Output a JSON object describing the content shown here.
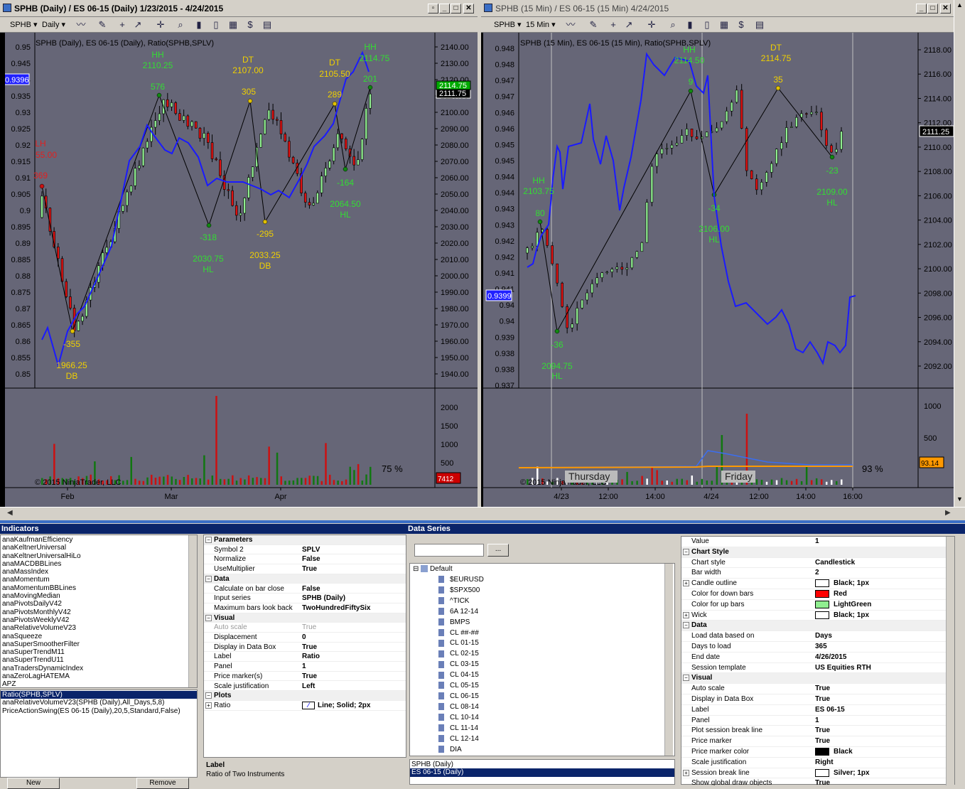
{
  "left_window": {
    "title": "SPHB (Daily) / ES 06-15 (Daily)  1/23/2015 - 4/24/2015",
    "instrument": "SPHB",
    "period": "Daily",
    "plot_label": "SPHB (Daily), ES 06-15 (Daily), Ratio(SPHB,SPLV)",
    "copyright": "© 2015 NinjaTrader, LLC",
    "pct": "75 %",
    "ratio_marker": "0.9396",
    "price_marker": "2111.75",
    "price_marker2": "2114.75",
    "vol_marker": "7412",
    "left_axis": [
      "0.95",
      "0.945",
      "0.94",
      "0.935",
      "0.93",
      "0.925",
      "0.92",
      "0.915",
      "0.91",
      "0.905",
      "0.9",
      "0.895",
      "0.89",
      "0.885",
      "0.88",
      "0.875",
      "0.87",
      "0.865",
      "0.86",
      "0.855",
      "0.85"
    ],
    "right_axis": [
      "2140.00",
      "2130.00",
      "2120.00",
      "2110.00",
      "2100.00",
      "2090.00",
      "2080.00",
      "2070.00",
      "2060.00",
      "2050.00",
      "2040.00",
      "2030.00",
      "2020.00",
      "2010.00",
      "2000.00",
      "1990.00",
      "1980.00",
      "1970.00",
      "1960.00",
      "1950.00",
      "1940.00"
    ],
    "vol_axis": [
      "2000",
      "1500",
      "1000",
      "500"
    ],
    "x_axis": [
      "Feb",
      "Mar",
      "Apr"
    ],
    "annotations": [
      {
        "t": "LH",
        "c": "#e02020"
      },
      {
        "t": "55.00",
        "c": "#e02020"
      },
      {
        "t": "369",
        "c": "#e02020"
      },
      {
        "t": "HH",
        "c": "#33dd33"
      },
      {
        "t": "2110.25",
        "c": "#33dd33"
      },
      {
        "t": "576",
        "c": "#33dd33"
      },
      {
        "t": "DT",
        "c": "#f0d000"
      },
      {
        "t": "2107.00",
        "c": "#f0d000"
      },
      {
        "t": "305",
        "c": "#f0d000"
      },
      {
        "t": "DT",
        "c": "#f0d000"
      },
      {
        "t": "2105.50",
        "c": "#f0d000"
      },
      {
        "t": "289",
        "c": "#f0d000"
      },
      {
        "t": "HH",
        "c": "#33dd33"
      },
      {
        "t": "2114.75",
        "c": "#33dd33"
      },
      {
        "t": "201",
        "c": "#33dd33"
      },
      {
        "t": "-318",
        "c": "#33dd33"
      },
      {
        "t": "2030.75",
        "c": "#33dd33"
      },
      {
        "t": "HL",
        "c": "#33dd33"
      },
      {
        "t": "-295",
        "c": "#f0d000"
      },
      {
        "t": "2033.25",
        "c": "#f0d000"
      },
      {
        "t": "DB",
        "c": "#f0d000"
      },
      {
        "t": "-164",
        "c": "#33dd33"
      },
      {
        "t": "2064.50",
        "c": "#33dd33"
      },
      {
        "t": "HL",
        "c": "#33dd33"
      },
      {
        "t": "-355",
        "c": "#f0d000"
      },
      {
        "t": "1966.25",
        "c": "#f0d000"
      },
      {
        "t": "DB",
        "c": "#f0d000"
      }
    ]
  },
  "right_window": {
    "title": "SPHB (15 Min) / ES 06-15 (15 Min)  4/24/2015",
    "instrument": "SPHB",
    "period": "15 Min",
    "plot_label": "SPHB (15 Min), ES 06-15 (15 Min), Ratio(SPHB,SPLV)",
    "copyright": "© 2015 NinjaTrader, LLC",
    "pct": "93 %",
    "ratio_marker": "0.9399",
    "price_marker": "2111.25",
    "vol_marker": "93.14",
    "session_labels": [
      "Thursday",
      "Friday"
    ],
    "left_axis": [
      "0.948",
      "0.948",
      "0.947",
      "0.947",
      "0.946",
      "0.946",
      "0.945",
      "0.945",
      "0.944",
      "0.944",
      "0.943",
      "0.943",
      "0.942",
      "0.942",
      "0.941",
      "0.941",
      "0.94",
      "0.94",
      "0.939",
      "0.938",
      "0.938",
      "0.937"
    ],
    "right_axis": [
      "2118.00",
      "2116.00",
      "2114.00",
      "2112.00",
      "2110.00",
      "2108.00",
      "2106.00",
      "2104.00",
      "2102.00",
      "2100.00",
      "2098.00",
      "2096.00",
      "2094.00",
      "2092.00"
    ],
    "vol_axis": [
      "1000",
      "500"
    ],
    "x_axis": [
      "4/23",
      "12:00",
      "14:00",
      "4/24",
      "12:00",
      "14:00",
      "16:00"
    ],
    "annotations": [
      {
        "t": "HH",
        "c": "#33dd33"
      },
      {
        "t": "2103.75",
        "c": "#33dd33"
      },
      {
        "t": "80",
        "c": "#33dd33"
      },
      {
        "t": "HH",
        "c": "#33dd33"
      },
      {
        "t": "2114.50",
        "c": "#33dd33"
      },
      {
        "t": "9",
        "c": "#33dd33"
      },
      {
        "t": "DT",
        "c": "#f0d000"
      },
      {
        "t": "2114.75",
        "c": "#f0d000"
      },
      {
        "t": "35",
        "c": "#f0d000"
      },
      {
        "t": "-36",
        "c": "#33dd33"
      },
      {
        "t": "2094.75",
        "c": "#33dd33"
      },
      {
        "t": "HL",
        "c": "#33dd33"
      },
      {
        "t": "-34",
        "c": "#33dd33"
      },
      {
        "t": "2106.00",
        "c": "#33dd33"
      },
      {
        "t": "HL",
        "c": "#33dd33"
      },
      {
        "t": "-23",
        "c": "#33dd33"
      },
      {
        "t": "2109.00",
        "c": "#33dd33"
      },
      {
        "t": "HL",
        "c": "#33dd33"
      }
    ]
  },
  "indicators": {
    "header": "Indicators",
    "available": [
      "anaKaufmanEfficiency",
      "anaKeltnerUniversal",
      "anaKeltnerUniversalHiLo",
      "anaMACDBBLines",
      "anaMassIndex",
      "anaMomentum",
      "anaMomentumBBLines",
      "anaMovingMedian",
      "anaPivotsDailyV42",
      "anaPivotsMonthlyV42",
      "anaPivotsWeeklyV42",
      "anaRelativeVolumeV23",
      "anaSqueeze",
      "anaSuperSmootherFilter",
      "anaSuperTrendM11",
      "anaSuperTrendU11",
      "anaTradersDynamicIndex",
      "anaZeroLagHATEMA",
      "APZ"
    ],
    "applied": [
      "Ratio(SPHB,SPLV)",
      "anaRelativeVolumeV23(SPHB (Daily),All_Days,5,8)",
      "PriceActionSwing(ES 06-15 (Daily),20,5,Standard,False)"
    ],
    "new_btn": "New",
    "remove_btn": "Remove",
    "properties": [
      {
        "cat": "Parameters"
      },
      {
        "k": "Symbol 2",
        "v": "SPLV"
      },
      {
        "k": "Normalize",
        "v": "False"
      },
      {
        "k": "UseMultiplier",
        "v": "True"
      },
      {
        "cat": "Data"
      },
      {
        "k": "Calculate on bar close",
        "v": "False"
      },
      {
        "k": "Input series",
        "v": "SPHB (Daily)"
      },
      {
        "k": "Maximum bars look back",
        "v": "TwoHundredFiftySix"
      },
      {
        "cat": "Visual"
      },
      {
        "k": "Auto scale",
        "v": "True",
        "grey": true
      },
      {
        "k": "Displacement",
        "v": "0"
      },
      {
        "k": "Display in Data Box",
        "v": "True"
      },
      {
        "k": "Label",
        "v": "Ratio"
      },
      {
        "k": "Panel",
        "v": "1"
      },
      {
        "k": "Price marker(s)",
        "v": "True"
      },
      {
        "k": "Scale justification",
        "v": "Left"
      },
      {
        "cat": "Plots"
      },
      {
        "k": "Ratio",
        "v": "Line; Solid; 2px",
        "exp": true
      }
    ],
    "desc_title": "Label",
    "desc_text": "Ratio of Two Instruments"
  },
  "data_series": {
    "header": "Data Series",
    "search_btn": "...",
    "tree_root": "Default",
    "instruments": [
      "$EURUSD",
      "$SPX500",
      "^TICK",
      "6A 12-14",
      "BMPS",
      "CL ##-##",
      "CL 01-15",
      "CL 02-15",
      "CL 03-15",
      "CL 04-15",
      "CL 05-15",
      "CL 06-15",
      "CL 08-14",
      "CL 10-14",
      "CL 11-14",
      "CL 12-14",
      "DIA"
    ],
    "selected": [
      "SPHB (Daily)",
      "ES 06-15 (Daily)"
    ],
    "properties": [
      {
        "k": "Value",
        "v": "1"
      },
      {
        "cat": "Chart Style"
      },
      {
        "k": "Chart style",
        "v": "Candlestick"
      },
      {
        "k": "Bar width",
        "v": "2"
      },
      {
        "k": "Candle outline",
        "v": "Black; 1px",
        "sw": "#ffffff",
        "exp": true
      },
      {
        "k": "Color for down bars",
        "v": "Red",
        "sw": "#ff0000"
      },
      {
        "k": "Color for up bars",
        "v": "LightGreen",
        "sw": "#90ee90"
      },
      {
        "k": "Wick",
        "v": "Black; 1px",
        "sw": "#ffffff",
        "exp": true
      },
      {
        "cat": "Data"
      },
      {
        "k": "Load data based on",
        "v": "Days"
      },
      {
        "k": "Days to load",
        "v": "365"
      },
      {
        "k": "End date",
        "v": "4/26/2015"
      },
      {
        "k": "Session template",
        "v": "US Equities RTH"
      },
      {
        "cat": "Visual"
      },
      {
        "k": "Auto scale",
        "v": "True"
      },
      {
        "k": "Display in Data Box",
        "v": "True"
      },
      {
        "k": "Label",
        "v": "ES 06-15"
      },
      {
        "k": "Panel",
        "v": "1"
      },
      {
        "k": "Plot session break line",
        "v": "True"
      },
      {
        "k": "Price marker",
        "v": "True"
      },
      {
        "k": "Price marker color",
        "v": "Black",
        "sw": "#000000"
      },
      {
        "k": "Scale justification",
        "v": "Right"
      },
      {
        "k": "Session break line",
        "v": "Silver; 1px",
        "sw": "#ffffff",
        "exp": true
      },
      {
        "k": "Show global draw objects",
        "v": "True"
      }
    ]
  },
  "colors": {
    "up": "#90ee90",
    "down": "#dd1111",
    "ratio": "#1a1aff",
    "bg": "#666677",
    "swing": "#000000"
  }
}
